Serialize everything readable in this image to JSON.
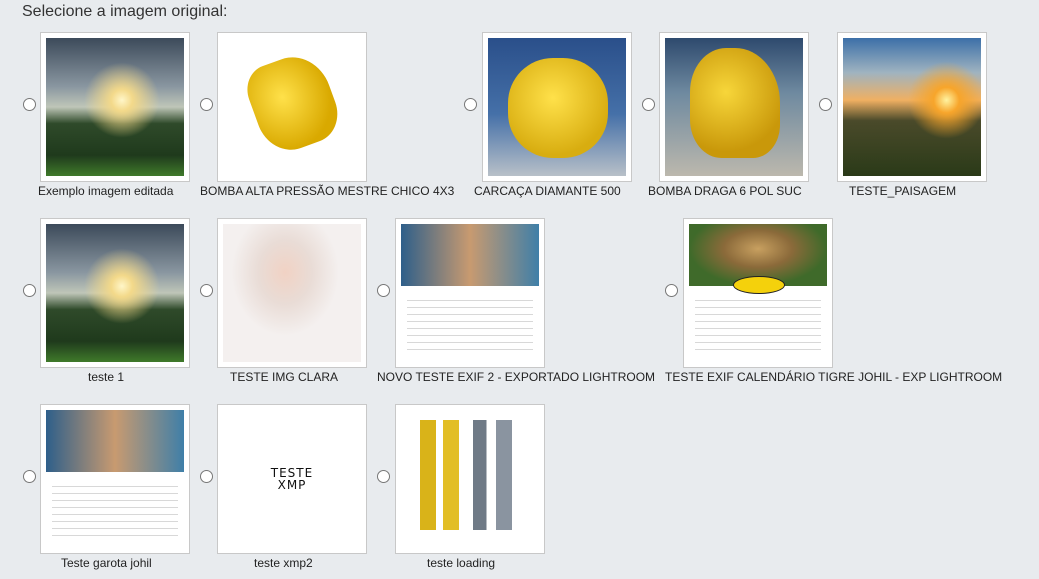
{
  "heading": "Selecione a imagem original:",
  "items": [
    {
      "caption": "Exemplo imagem editada",
      "image": "landscape",
      "selected": false
    },
    {
      "caption": "BOMBA ALTA PRESSÃO MESTRE CHICO 4X3",
      "image": "yellow-pump",
      "selected": false
    },
    {
      "caption": "CARCAÇA DIAMANTE 500",
      "image": "yellow-pump",
      "selected": false
    },
    {
      "caption": "BOMBA DRAGA 6 POL SUC",
      "image": "yellow-pump",
      "selected": false
    },
    {
      "caption": "TESTE_PAISAGEM",
      "image": "sunset",
      "selected": false
    },
    {
      "caption": "teste 1",
      "image": "landscape",
      "selected": false
    },
    {
      "caption": "TESTE IMG CLARA",
      "image": "baby-photo",
      "selected": false
    },
    {
      "caption": "NOVO TESTE EXIF 2 - EXPORTADO LIGHTROOM",
      "image": "calendar",
      "selected": false
    },
    {
      "caption": "TESTE EXIF CALENDÁRIO TIGRE JOHIL - EXP LIGHTROOM",
      "image": "calendar-jaguar",
      "selected": false
    },
    {
      "caption": "Teste garota johil",
      "image": "calendar",
      "selected": false
    },
    {
      "caption": "teste xmp2",
      "image": "xmp-text",
      "image_text": [
        "TESTE",
        "XMP"
      ],
      "selected": false
    },
    {
      "caption": "teste loading",
      "image": "tubes",
      "selected": false
    }
  ]
}
